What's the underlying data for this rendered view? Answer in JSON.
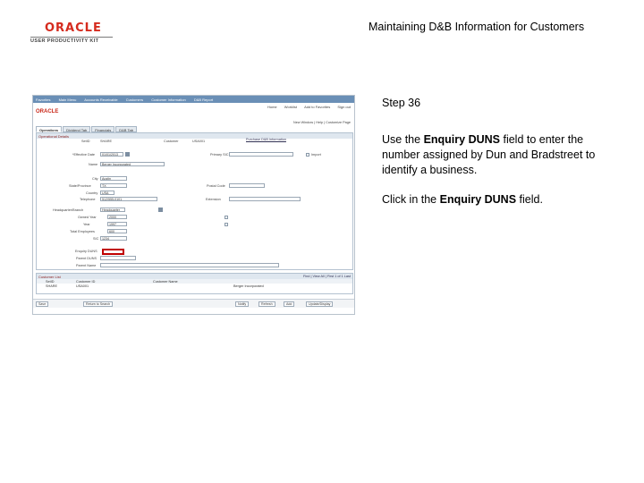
{
  "logo": {
    "brand": "ORACLE",
    "product": "USER PRODUCTIVITY KIT"
  },
  "slide_title": "Maintaining D&B Information for Customers",
  "step": {
    "label": "Step 36"
  },
  "instruction": {
    "line1_pre": "Use the ",
    "field_name": "Enquiry DUNS",
    "line1_post": " field to enter the number assigned by Dun and Bradstreet to identify a business.",
    "action_pre": "Click in the ",
    "action_field": "Enquiry DUNS",
    "action_post": " field."
  },
  "screenshot": {
    "menu": [
      "Favorites",
      "Main Menu",
      "Accounts Receivable",
      "Customers",
      "Customer Information",
      "D&B Report"
    ],
    "toplinks": [
      "Home",
      "Worklist",
      "Add to Favorites",
      "Sign out"
    ],
    "new_window": "New Window | Help | Customize Page",
    "tabs": [
      "Operations",
      "Dividend Tab",
      "Financials",
      "D&B Tab"
    ],
    "panel_title": "Operational Details",
    "fields": {
      "setid_label": "SetID",
      "setid_value": "SHARE",
      "customer_label": "Customer",
      "customer_value": "USA001",
      "eff_date_label": "*Effective Date",
      "eff_date_value": "01/01/2013",
      "name_label": "Name",
      "name_value": "Berger Incorporated",
      "city_label": "City",
      "city_value": "Austin",
      "state_label": "State/Province",
      "state_value": "TX",
      "country_label": "Country",
      "country_value": "USA",
      "telephone_label": "Telephone",
      "telephone_value": "512/555-0101",
      "postal_label": "Postal Code",
      "ext_label": "Extension",
      "hq_label": "Headquarter/Branch",
      "hq_value": "Headquarter",
      "owned_label": "Owned Year",
      "owned_value": "2000",
      "year_label": "Year",
      "year_value": "1997",
      "employees_label": "Total Employees",
      "employees_value": "600",
      "sic_label": "SIC",
      "sic_value": "1234",
      "enquiry_label": "Enquiry DUNS",
      "parent_label": "Parent DUNS",
      "parent_name_label": "Parent Name",
      "primary_sic_label": "Primary SIC",
      "purchase_label": "Purchase D&B Information",
      "import_label": "Import"
    },
    "grid": {
      "title": "Customer List",
      "nav": "Find | View All | First 1 of 1 Last",
      "cols": [
        "SetID",
        "Customer ID",
        "Customer Name"
      ],
      "row": [
        "SHARE",
        "USA001",
        "Berger Incorporated"
      ]
    },
    "toolbar": [
      "Save",
      "Return to Search",
      "Notify",
      "Refresh",
      "Add",
      "Update/Display"
    ]
  }
}
